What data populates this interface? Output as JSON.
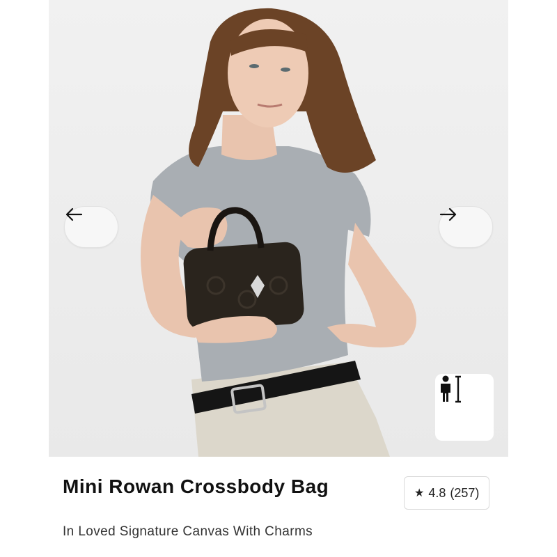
{
  "product": {
    "name": "Mini Rowan Crossbody Bag",
    "subtitle": "In Loved Signature Canvas With Charms",
    "rating": "4.8",
    "review_count": "(257)"
  },
  "gallery": {
    "prev_icon": "arrow-left-icon",
    "next_icon": "arrow-right-icon",
    "size_guide_icon": "person-height-icon"
  },
  "colors": {
    "bag": "#2a241d",
    "shirt": "#a9aeb3",
    "jeans": "#d9d4c8",
    "hair": "#6b4326",
    "background": "#ececec"
  }
}
